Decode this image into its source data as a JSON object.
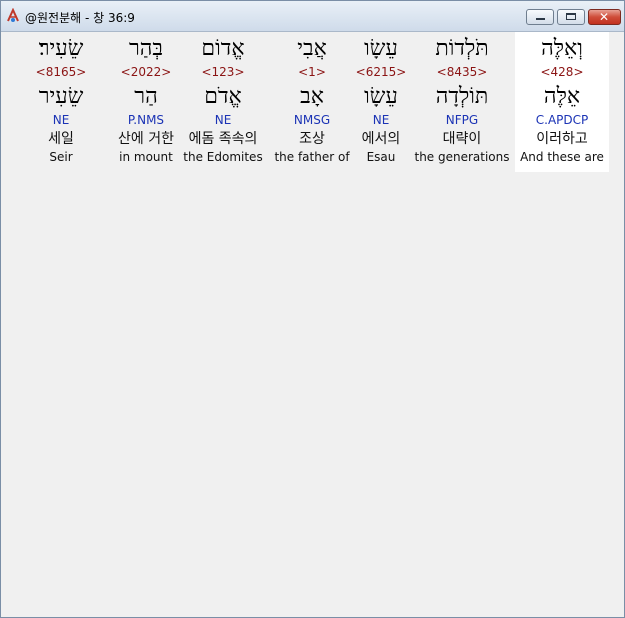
{
  "window": {
    "title": "@원전분해 - 창 36:9",
    "buttons": {
      "minimize": "",
      "maximize": "",
      "close": "✕"
    }
  },
  "words": [
    {
      "hebrew": "שֵׂעִיר׃",
      "strong": "<8165>",
      "lemma": "שֵׂעִיר",
      "morph": "NE",
      "korean": "세일",
      "english": "Seir"
    },
    {
      "hebrew": "בְּהַר",
      "strong": "<2022>",
      "lemma": "הַר",
      "morph": "P.NMS",
      "korean": "산에 거한",
      "english": "in mount"
    },
    {
      "hebrew": "אֱדוֹם",
      "strong": "<123>",
      "lemma": "אֱדֹם",
      "morph": "NE",
      "korean": "에돔 족속의",
      "english": "the Edomites"
    },
    {
      "hebrew": "אֲבִי",
      "strong": "<1>",
      "lemma": "אָב",
      "morph": "NMSG",
      "korean": "조상",
      "english": "the father of"
    },
    {
      "hebrew": "עֵשָׂו",
      "strong": "<6215>",
      "lemma": "עֵשָׂו",
      "morph": "NE",
      "korean": "에서의",
      "english": "Esau"
    },
    {
      "hebrew": "תֹּלְדוֹת",
      "strong": "<8435>",
      "lemma": "תּוֹלְדָה",
      "morph": "NFPG",
      "korean": "대략이",
      "english": "the generations"
    },
    {
      "hebrew": "וְאֵלֶּה",
      "strong": "<428>",
      "lemma": "אֵלֶּה",
      "morph": "C.APDCP",
      "korean": "이러하고",
      "english": "And these are"
    }
  ]
}
